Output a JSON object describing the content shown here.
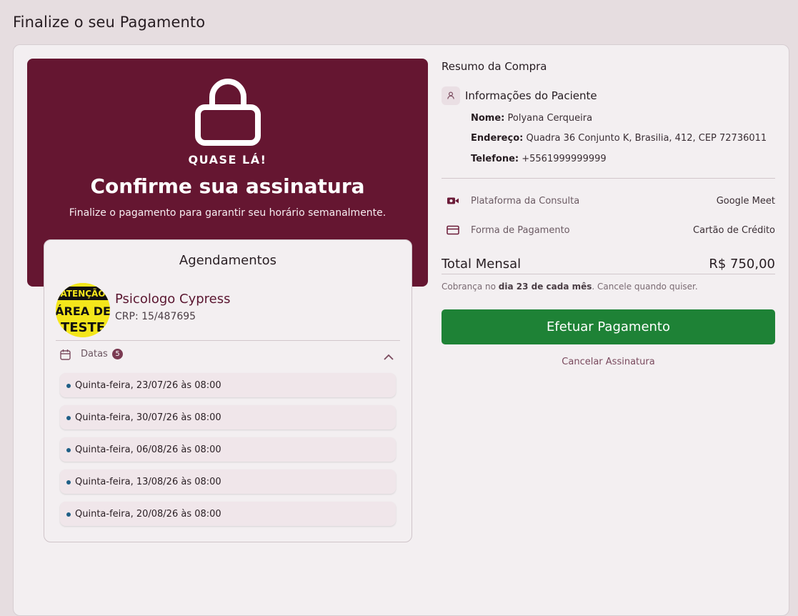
{
  "page": {
    "title": "Finalize o seu Pagamento"
  },
  "hero": {
    "kicker": "QUASE LÁ!",
    "title": "Confirme sua assinatura",
    "subtitle": "Finalize o pagamento para garantir seu horário semanalmente.",
    "icon": "lock-icon",
    "bg_color": "#651631"
  },
  "schedule": {
    "title": "Agendamentos",
    "psychologist": {
      "name": "Psicologo Cypress",
      "crp": "CRP: 15/487695",
      "avatar_lines": [
        "ATENÇÃO",
        "ÁREA DE",
        "TESTE"
      ]
    },
    "dates_label": "Datas",
    "dates_count": "5",
    "dates": [
      "Quinta-feira, 23/07/26 às 08:00",
      "Quinta-feira, 30/07/26 às 08:00",
      "Quinta-feira, 06/08/26 às 08:00",
      "Quinta-feira, 13/08/26 às 08:00",
      "Quinta-feira, 20/08/26 às 08:00"
    ]
  },
  "summary": {
    "title": "Resumo da Compra",
    "patient_header": "Informações do Paciente",
    "name_label": "Nome:",
    "name_value": "Polyana Cerqueira",
    "address_label": "Endereço:",
    "address_value": "Quadra 36 Conjunto K, Brasilia, 412, CEP 72736011",
    "phone_label": "Telefone:",
    "phone_value": "+5561999999999",
    "platform_label": "Plataforma da Consulta",
    "platform_value": "Google Meet",
    "payment_label": "Forma de Pagamento",
    "payment_value": "Cartão de Crédito",
    "total_label": "Total Mensal",
    "total_value": "R$ 750,00",
    "billing_prefix": "Cobrança no",
    "billing_day": "dia 23 de cada mês",
    "billing_suffix": ". Cancele quando quiser.",
    "pay_button": "Efetuar Pagamento",
    "cancel_link": "Cancelar Assinatura",
    "pay_color": "#1e8236"
  }
}
